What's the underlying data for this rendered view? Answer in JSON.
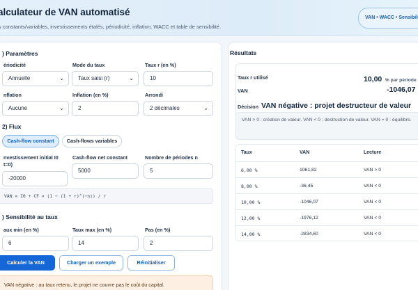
{
  "header": {
    "title": "alculateur de VAN automatisé",
    "subtitle": "s constants/variables, investissements étalés, périodicité, inflation, WACC et table de sensibilité.",
    "badge": "VAN • WACC • Sensibilité"
  },
  "params": {
    "section_title": ") Paramètres",
    "periodicity": {
      "label": "ériodicité",
      "value": "Annuelle"
    },
    "rate_mode": {
      "label": "Mode du taux",
      "value": "Taux saisi (r)"
    },
    "rate": {
      "label": "Taux r (en %)",
      "value": "10"
    },
    "inflation": {
      "label": "nflation",
      "value": "Aucune"
    },
    "inflation_pct": {
      "label": "Inflation (en %)",
      "value": "2"
    },
    "rounding": {
      "label": "Arrondi",
      "value": "2 décimales"
    }
  },
  "flux": {
    "section_title": "2) Flux",
    "tab_constant": "Cash-flow constant",
    "tab_variable": "Cash-flows variables",
    "investment": {
      "label_line1": "nvestissement initial I0",
      "label_line2": "t=0)",
      "value": "-20000"
    },
    "cf": {
      "label": "Cash-flow net constant",
      "value": "5000"
    },
    "periods": {
      "label": "Nombre de périodes n",
      "value": "5"
    },
    "formula": "VAN = I0 + CF × (1 − (1 + r)^(−n)) / r"
  },
  "sensitivity": {
    "section_title": ") Sensibilité au taux",
    "min": {
      "label": "aux min (en %)",
      "value": "6"
    },
    "max": {
      "label": "Taux max (en %)",
      "value": "14"
    },
    "step": {
      "label": "Pas (en %)",
      "value": "2"
    }
  },
  "actions": {
    "calculate": "Calculer la VAN",
    "example": "Charger un exemple",
    "reset": "Réinitialiser"
  },
  "alert": "VAN négative : au taux retenu, le projet ne couvre pas le coût du capital.",
  "results": {
    "title": "Résultats",
    "rate_label": "Taux r utilisé",
    "rate_value": "10,00",
    "rate_unit": "% par période",
    "van_label": "VAN",
    "van_value": "-1046,07",
    "decision_label": "Décision",
    "decision_value": "VAN négative : projet destructeur de valeur",
    "note": "VAN > 0 : création de valeur. VAN < 0 : destruction de valeur. VAN = 0 : équilibre.",
    "table_headers": [
      "Taux",
      "VAN",
      "Lecture"
    ],
    "table_rows": [
      {
        "rate": "6,00 %",
        "van": "1061,82",
        "reading": "VAN > 0"
      },
      {
        "rate": "8,00 %",
        "van": "-36,45",
        "reading": "VAN < 0"
      },
      {
        "rate": "10,00 %",
        "van": "-1046,07",
        "reading": "VAN < 0"
      },
      {
        "rate": "12,00 %",
        "van": "-1976,12",
        "reading": "VAN < 0"
      },
      {
        "rate": "14,00 %",
        "van": "-2834,60",
        "reading": "VAN < 0"
      }
    ]
  }
}
